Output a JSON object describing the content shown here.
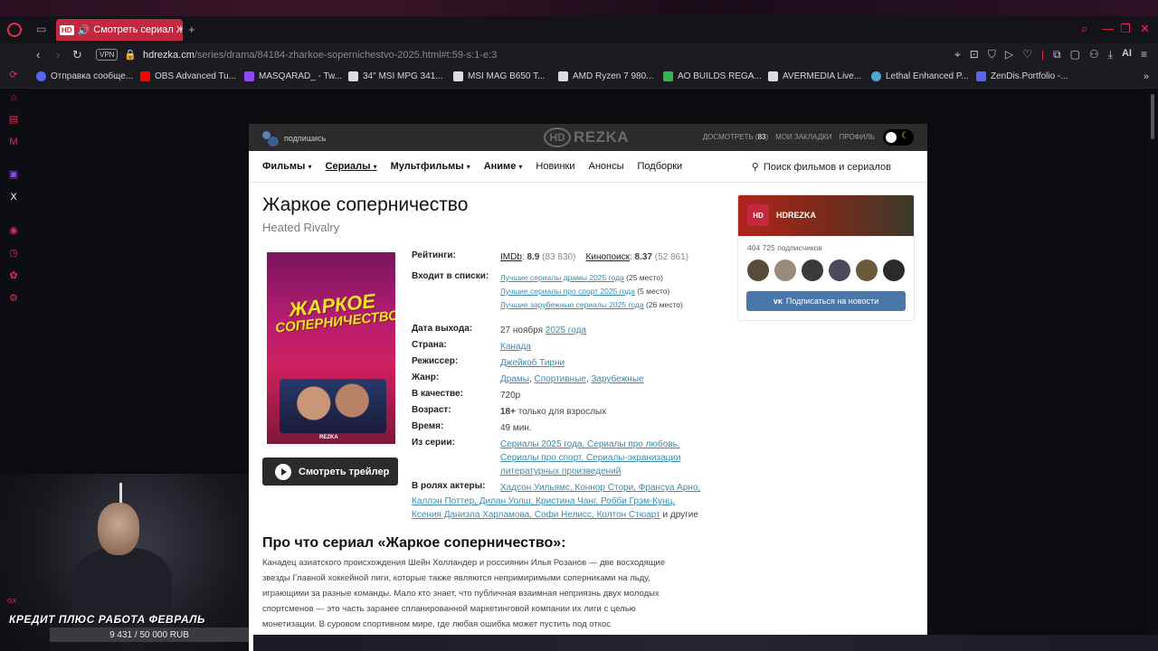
{
  "browser": {
    "tab": {
      "favicon": "HD",
      "title": "Смотреть сериал Жар"
    },
    "address": {
      "vpn": "VPN",
      "host": "hdrezka.cm",
      "path": "/series/drama/84184-zharkoe-sopernichestvo-2025.html#t:59-s:1-e:3"
    },
    "ai_label": "AI",
    "bookmarks": [
      {
        "label": "Отправка сообще...",
        "color": "#5865f2"
      },
      {
        "label": "OBS Advanced Tu...",
        "color": "#ff0000"
      },
      {
        "label": "MASQARAD_ - Tw...",
        "color": "#9146ff"
      },
      {
        "label": "34\" MSI MPG 341...",
        "color": "#ffffff"
      },
      {
        "label": "MSI MAG B650 T...",
        "color": "#ffffff"
      },
      {
        "label": "AMD Ryzen 7 980...",
        "color": "#ffffff"
      },
      {
        "label": "AO BUILDS REGA...",
        "color": "#2db84c"
      },
      {
        "label": "AVERMEDIA Live...",
        "color": "#ffffff"
      },
      {
        "label": "Lethal Enhanced P...",
        "color": "#4aa8d8"
      },
      {
        "label": "ZenDis.Portfolio -...",
        "color": "#5865f2"
      }
    ]
  },
  "site": {
    "subscribe": "подпишись",
    "logo_hd": "HD",
    "logo_text": "REZKA",
    "top_links": {
      "watch": "ДОСМОТРЕТЬ",
      "watch_count": "83",
      "bookmarks": "МОИ ЗАКЛАДКИ",
      "profile": "ПРОФИЛЬ"
    },
    "nav": {
      "films": "Фильмы",
      "series": "Сериалы",
      "cartoons": "Мультфильмы",
      "anime": "Аниме",
      "new": "Новинки",
      "announce": "Анонсы",
      "collections": "Подборки"
    },
    "search_placeholder": "Поиск фильмов и сериалов",
    "title_ru": "Жаркое соперничество",
    "title_en": "Heated Rivalry",
    "poster_title_line1": "ЖАРКОЕ",
    "poster_title_line2": "СОПЕРНИЧЕСТВО",
    "poster_logo": "REZKA",
    "trailer_button": "Смотреть трейлер",
    "info": {
      "ratings_label": "Рейтинги:",
      "imdb_name": "IMDb",
      "imdb_value": "8.9",
      "imdb_votes": "(83 830)",
      "kp_name": "Кинопоиск",
      "kp_value": "8.37",
      "kp_votes": "(52 861)",
      "lists_label": "Входит в списки:",
      "lists": [
        {
          "link": "Лучшие сериалы драмы 2025 года",
          "place": "(25 место)"
        },
        {
          "link": "Лучшие сериалы про спорт 2025 года",
          "place": "(5 место)"
        },
        {
          "link": "Лучшие зарубежные сериалы 2025 года",
          "place": "(26 место)"
        }
      ],
      "date_label": "Дата выхода:",
      "date_text": "27 ноября",
      "date_year": "2025 года",
      "country_label": "Страна:",
      "country": "Канада",
      "director_label": "Режиссер:",
      "director": "Джейкоб Тирни",
      "genre_label": "Жанр:",
      "genres": [
        "Драмы",
        "Спортивные",
        "Зарубежные"
      ],
      "quality_label": "В качестве:",
      "quality": "720p",
      "age_label": "Возраст:",
      "age_value": "18+",
      "age_text": "только для взрослых",
      "time_label": "Время:",
      "time": "49 мин.",
      "from_label": "Из серии:",
      "from_lines": [
        "Сериалы 2025 года, Сериалы про любовь,",
        "Сериалы про спорт, Сериалы-экранизации",
        "литературных произведений"
      ],
      "cast_label": "В ролях актеры:",
      "cast_lines": [
        "Хадсон Уильямс, Коннор Стори, Франсуа Арно,",
        "Каллэн Поттер, Дилан Уолш, Кристина Чанг, Робби Грэм-Кунц,",
        "Ксения Даниэла Харламова, Софи Нелисс, Колтон Стюарт"
      ],
      "cast_more": "и другие"
    },
    "about_title": "Про что сериал «Жаркое соперничество»:",
    "about_lines": [
      "Канадец азиатского происхождения Шейн Холландер и россиянин Илья Розанов — две восходящие",
      "звезды Главной хоккейной лиги, которые также являются непримиримыми соперниками на льду,",
      "играющими за разные команды. Мало кто знает, что публичная взаимная неприязнь двух молодых",
      "спортсменов — это часть заранее спланированной маркетинговой компании их лиги с целью",
      "монетизации. В суровом спортивном мире, где любая ошибка может пустить под откос"
    ],
    "vk": {
      "avatar": "HD",
      "name": "HDREZKA",
      "subscribers": "404 725 подписчиков",
      "button": "Подписаться на новости"
    }
  },
  "stream": {
    "gx": "GX",
    "banner": "КРЕДИТ ПЛЮС РАБОТА ФЕВРАЛЬ",
    "goal": "9 431 / 50 000 RUB"
  },
  "colors": {
    "accent": "#e3304c",
    "link": "#3a8bb0",
    "vk": "#4a76a8"
  }
}
